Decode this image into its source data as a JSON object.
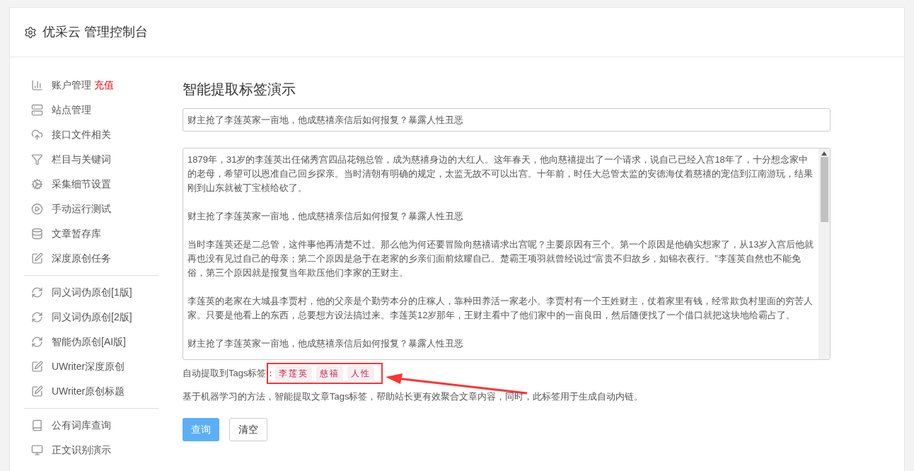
{
  "header": {
    "title": "优采云 管理控制台"
  },
  "sidebar": {
    "groups": [
      [
        {
          "label": "账户管理",
          "badge": "充值"
        },
        {
          "label": "站点管理"
        },
        {
          "label": "接口文件相关"
        },
        {
          "label": "栏目与关键词"
        },
        {
          "label": "采集细节设置"
        },
        {
          "label": "手动运行测试"
        },
        {
          "label": "文章暂存库"
        },
        {
          "label": "深度原创任务"
        }
      ],
      [
        {
          "label": "同义词伪原创[1版]"
        },
        {
          "label": "同义词伪原创[2版]"
        },
        {
          "label": "智能伪原创[AI版]"
        },
        {
          "label": "UWriter深度原创"
        },
        {
          "label": "UWriter原创标题"
        }
      ],
      [
        {
          "label": "公有词库查询"
        },
        {
          "label": "正文识别演示"
        }
      ]
    ]
  },
  "main": {
    "title": "智能提取标签演示",
    "title_field": {
      "value": "财主抢了李莲英家一亩地，他成慈禧亲信后如何报复？暴露人性丑恶"
    },
    "content_field": {
      "paragraphs": [
        "1879年，31岁的李莲英出任储秀宫四品花翎总管，成为慈禧身边的大红人。这年春天，他向慈禧提出了一个请求，说自己已经入宫18年了，十分想念家中的老母，希望可以恩准自己回乡探亲。当时清朝有明确的规定，太监无故不可以出宫。十年前，时任大总管太监的安德海仗着慈禧的宠信到江南游玩，结果刚到山东就被丁宝桢给砍了。",
        "财主抢了李莲英家一亩地，他成慈禧亲信后如何报复？暴露人性丑恶",
        "当时李莲英还是二总管，这件事他再清楚不过。那么他为何还要冒险向慈禧请求出宫呢？主要原因有三个。第一个原因是他确实想家了，从13岁入宫后他就再也没有见过自己的母亲；第二个原因是急于在老家的乡亲们面前炫耀自己。楚霸王项羽就曾经说过“富贵不归故乡，如锦衣夜行。”李莲英自然也不能免俗，第三个原因就是报复当年欺压他们李家的王财主。",
        "李莲英的老家在大城县李贾村，他的父亲是个勤劳本分的庄稼人，靠种田养活一家老小。李贾村有一个王姓财主，仗着家里有钱，经常欺负村里面的穷苦人家。只要是他看上的东西，总要想方设法搞过来。李莲英12岁那年，王财主看中了他们家中的一亩良田，然后随便找了一个借口就把这块地给霸占了。",
        "财主抢了李莲英家一亩地，他成慈禧亲信后如何报复？暴露人性丑恶"
      ]
    },
    "tags_label": "自动提取到Tags标签：",
    "tags": [
      "李莲英",
      "慈禧",
      "人性"
    ],
    "description": "基于机器学习的方法，智能提取文章Tags标签，帮助站长更有效聚合文章内容，同时，此标签用于生成自动内链。",
    "buttons": [
      {
        "label": "查询",
        "kind": "primary"
      },
      {
        "label": "清空",
        "kind": "default"
      }
    ]
  }
}
